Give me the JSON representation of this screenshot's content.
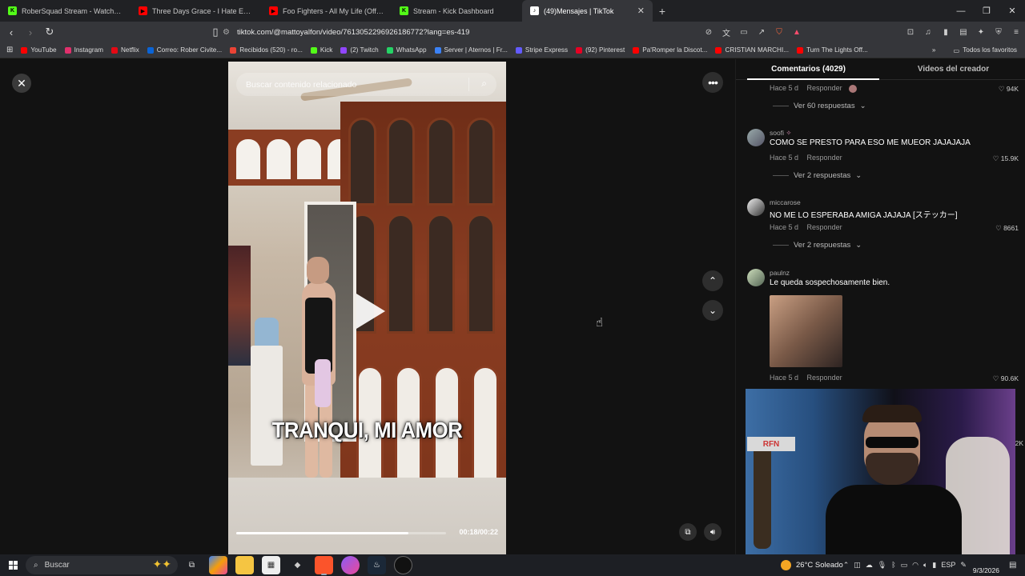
{
  "browser": {
    "tabs": [
      {
        "title": "RoberSquad Stream - Watch Live",
        "favicon_color": "#53fc18",
        "favicon_glyph": "K",
        "active": false
      },
      {
        "title": "Three Days Grace - I Hate Everything",
        "favicon_color": "#ff0000",
        "favicon_glyph": "▶",
        "active": false
      },
      {
        "title": "Foo Fighters - All My Life (Official HD",
        "favicon_color": "#ff0000",
        "favicon_glyph": "▶",
        "active": false
      },
      {
        "title": "Stream - Kick Dashboard",
        "favicon_color": "#53fc18",
        "favicon_glyph": "K",
        "active": false
      },
      {
        "title": "(49)Mensajes | TikTok",
        "favicon_color": "#ffffff",
        "favicon_glyph": "♪",
        "active": true
      }
    ],
    "new_tab_glyph": "+",
    "url": "tiktok.com/@mattoyalfon/video/7613052296926186772?lang=es-419",
    "bookmarks": [
      {
        "label": "YouTube",
        "color": "#ff0000"
      },
      {
        "label": "Instagram",
        "color": "#e1306c"
      },
      {
        "label": "Netflix",
        "color": "#e50914"
      },
      {
        "label": "Correo: Rober Civite...",
        "color": "#0a64d6"
      },
      {
        "label": "Recibidos (520) - ro...",
        "color": "#ea4335"
      },
      {
        "label": "Kick",
        "color": "#53fc18"
      },
      {
        "label": "(2) Twitch",
        "color": "#9146ff"
      },
      {
        "label": "WhatsApp",
        "color": "#25d366"
      },
      {
        "label": "Server | Aternos | Fr...",
        "color": "#3b82f6"
      },
      {
        "label": "Stripe Express",
        "color": "#635bff"
      },
      {
        "label": "(92) Pinterest",
        "color": "#e60023"
      },
      {
        "label": "Pa'Romper la Discot...",
        "color": "#ff0000"
      },
      {
        "label": "CRISTIAN MARCHI...",
        "color": "#ff0000"
      },
      {
        "label": "Turn The Lights Off...",
        "color": "#ff0000"
      }
    ],
    "all_favorites": "Todos los favoritos"
  },
  "video": {
    "search_placeholder": "Buscar contenido relacionado",
    "caption": "TRANQUI, MI AMOR",
    "time": "00:18/00:22",
    "progress": 0.82
  },
  "comments": {
    "tab_comments": "Comentarios (4029)",
    "tab_creator": "Videos del creador",
    "items": [
      {
        "user": "",
        "text": "",
        "time": "Hace 5 d",
        "reply": "Responder",
        "likes": "94K",
        "replies": "Ver 60 respuestas"
      },
      {
        "user": "soofi",
        "text": "COMO SE PRESTO PARA ESO ME MUEOR JAJAJAJA",
        "time": "Hace 5 d",
        "reply": "Responder",
        "likes": "15.9K",
        "replies": "Ver 2 respuestas"
      },
      {
        "user": "miccarose",
        "text": "NO ME LO ESPERABA AMIGA JAJAJA [ステッカー]",
        "time": "Hace 5 d",
        "reply": "Responder",
        "likes": "8661",
        "replies": "Ver 2 respuestas"
      },
      {
        "user": "paulnz",
        "text": "Le queda sospechosamente bien.",
        "time": "Hace 5 d",
        "reply": "Responder",
        "likes": "90.6K",
        "replies": ""
      }
    ],
    "partial_likes": "2K"
  },
  "webcam_sign": "RFN",
  "taskbar": {
    "search_label": "Buscar",
    "weather": "26°C  Soleado",
    "lang": "ESP",
    "date": "9/3/2026"
  }
}
